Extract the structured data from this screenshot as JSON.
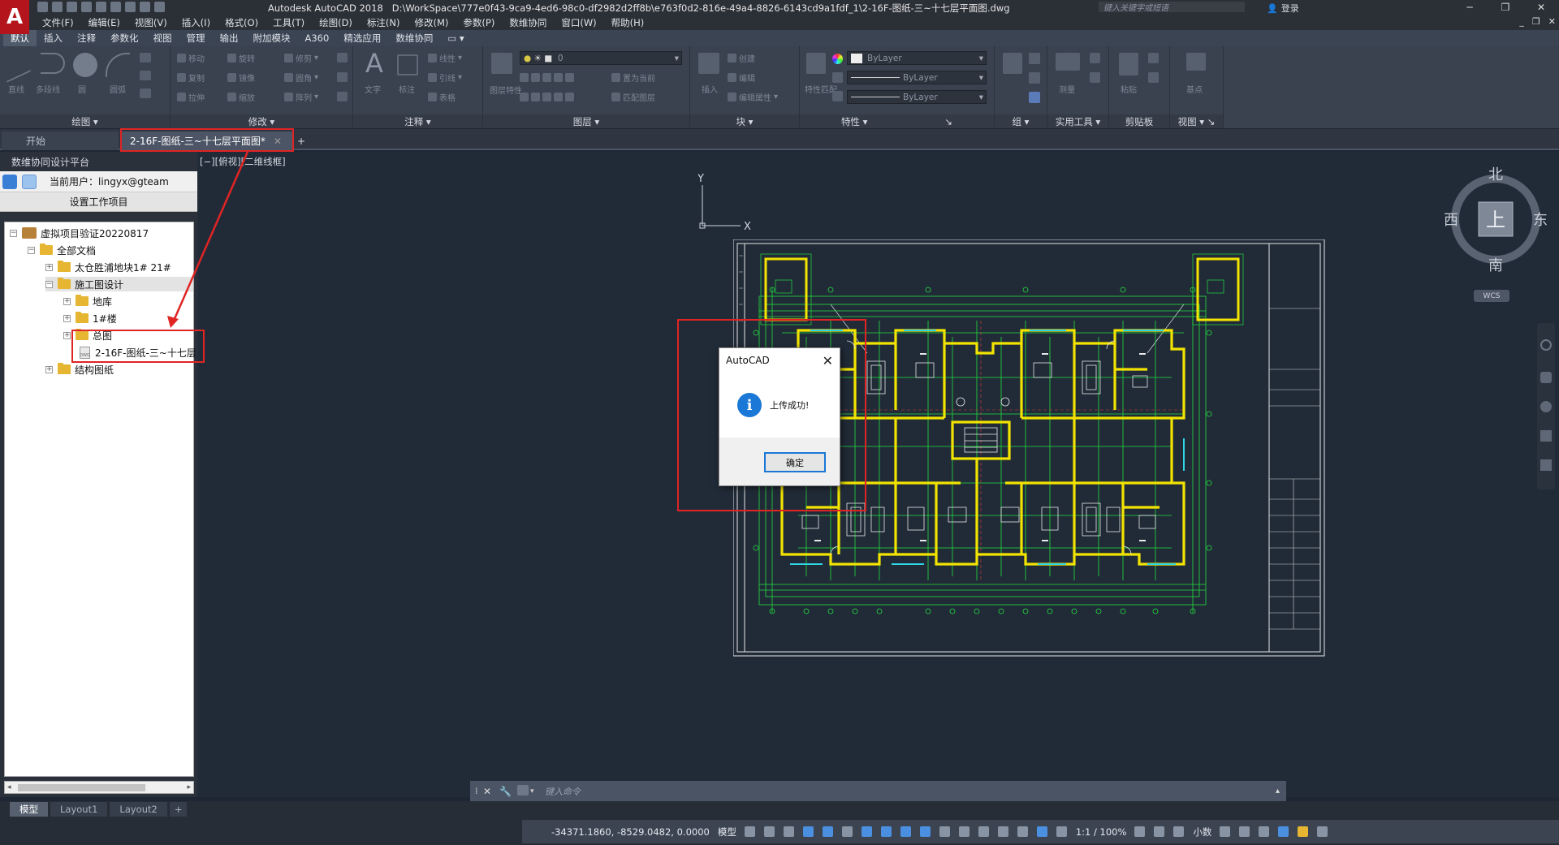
{
  "window": {
    "app_title": "Autodesk AutoCAD 2018",
    "file_path": "D:\\WorkSpace\\777e0f43-9ca9-4ed6-98c0-df2982d2ff8b\\e763f0d2-816e-49a4-8826-6143cd9a1fdf_1\\2-16F-图纸-三~十七层平面图.dwg",
    "search_placeholder": "键入关键字或短语",
    "login_label": "登录",
    "logo_letter": "A"
  },
  "menubar": {
    "items": [
      "文件(F)",
      "编辑(E)",
      "视图(V)",
      "插入(I)",
      "格式(O)",
      "工具(T)",
      "绘图(D)",
      "标注(N)",
      "修改(M)",
      "参数(P)",
      "数维协同",
      "窗口(W)",
      "帮助(H)"
    ]
  },
  "ribbon": {
    "tabs": [
      "默认",
      "插入",
      "注释",
      "参数化",
      "视图",
      "管理",
      "输出",
      "附加模块",
      "A360",
      "精选应用",
      "数维协同"
    ],
    "groups": {
      "draw": "绘图",
      "modify": "修改",
      "annotate": "注释",
      "layers": "图层",
      "block": "块",
      "properties": "特性",
      "group": "组",
      "utilities": "实用工具",
      "clipboard": "剪贴板",
      "view": "视图"
    },
    "draw_tools": [
      "直线",
      "多段线",
      "圆",
      "圆弧"
    ],
    "modify_tools": [
      "移动",
      "旋转",
      "修剪",
      "复制",
      "镜像",
      "圆角",
      "拉伸",
      "缩放",
      "阵列"
    ],
    "annotate_tools": [
      "文字",
      "标注",
      "线性",
      "引线",
      "表格"
    ],
    "layer_tools": [
      "图层特性",
      "置为当前",
      "匹配图层"
    ],
    "layer_value": "0",
    "block_tools": [
      "插入",
      "创建",
      "编辑",
      "编辑属性"
    ],
    "props": {
      "color": "ByLayer",
      "linetype": "ByLayer",
      "lineweight": "ByLayer",
      "match": "特性匹配"
    },
    "utilities_tools": [
      "测量"
    ],
    "clipboard_tools": [
      "粘贴"
    ],
    "view_tools": [
      "基点"
    ]
  },
  "filetabs": {
    "start": "开始",
    "active": "2-16F-图纸-三~十七层平面图*",
    "close": "✕",
    "add": "+"
  },
  "leftpanel": {
    "title": "数维协同设计平台",
    "user_label": "当前用户：lingyx@gteam",
    "set_project": "设置工作项目",
    "tree": [
      {
        "label": "虚拟项目验证20220817",
        "type": "project",
        "toggle": "⊟"
      },
      {
        "label": "全部文档",
        "type": "folder",
        "toggle": "⊟"
      },
      {
        "label": "太仓胜浦地块1# 21#",
        "type": "folder",
        "toggle": "⊞"
      },
      {
        "label": "施工图设计",
        "type": "folder",
        "toggle": "⊟"
      },
      {
        "label": "地库",
        "type": "folder",
        "toggle": "⊞"
      },
      {
        "label": "1#楼",
        "type": "folder",
        "toggle": "⊞"
      },
      {
        "label": "总图",
        "type": "folder",
        "toggle": "⊞"
      },
      {
        "label": "2-16F-图纸-三~十七层",
        "type": "dwg",
        "toggle": ""
      },
      {
        "label": "结构图纸",
        "type": "folder",
        "toggle": "⊞"
      }
    ],
    "dwg_badge": "DWG"
  },
  "viewport": {
    "label": "[−][俯视][二维线框]",
    "ucs_x": "X",
    "ucs_y": "Y",
    "viewcube": {
      "north": "北",
      "south": "南",
      "east": "东",
      "west": "西",
      "top": "上"
    },
    "wcs": "WCS"
  },
  "dialog": {
    "title": "AutoCAD",
    "message": "上传成功!",
    "ok": "确定",
    "close": "✕",
    "icon": "i"
  },
  "cmdline": {
    "placeholder": "键入命令"
  },
  "layouttabs": [
    "模型",
    "Layout1",
    "Layout2",
    "+"
  ],
  "statusbar": {
    "coords": "-34371.1860, -8529.0482, 0.0000",
    "model": "模型",
    "scale": "1:1 / 100%",
    "units": "小数"
  },
  "colors": {
    "accent_red": "#e02424",
    "dialog_blue": "#1b78d6",
    "wall_yellow": "#f2e400",
    "line_green": "#22e03c",
    "cyan": "#2fd6e6"
  }
}
